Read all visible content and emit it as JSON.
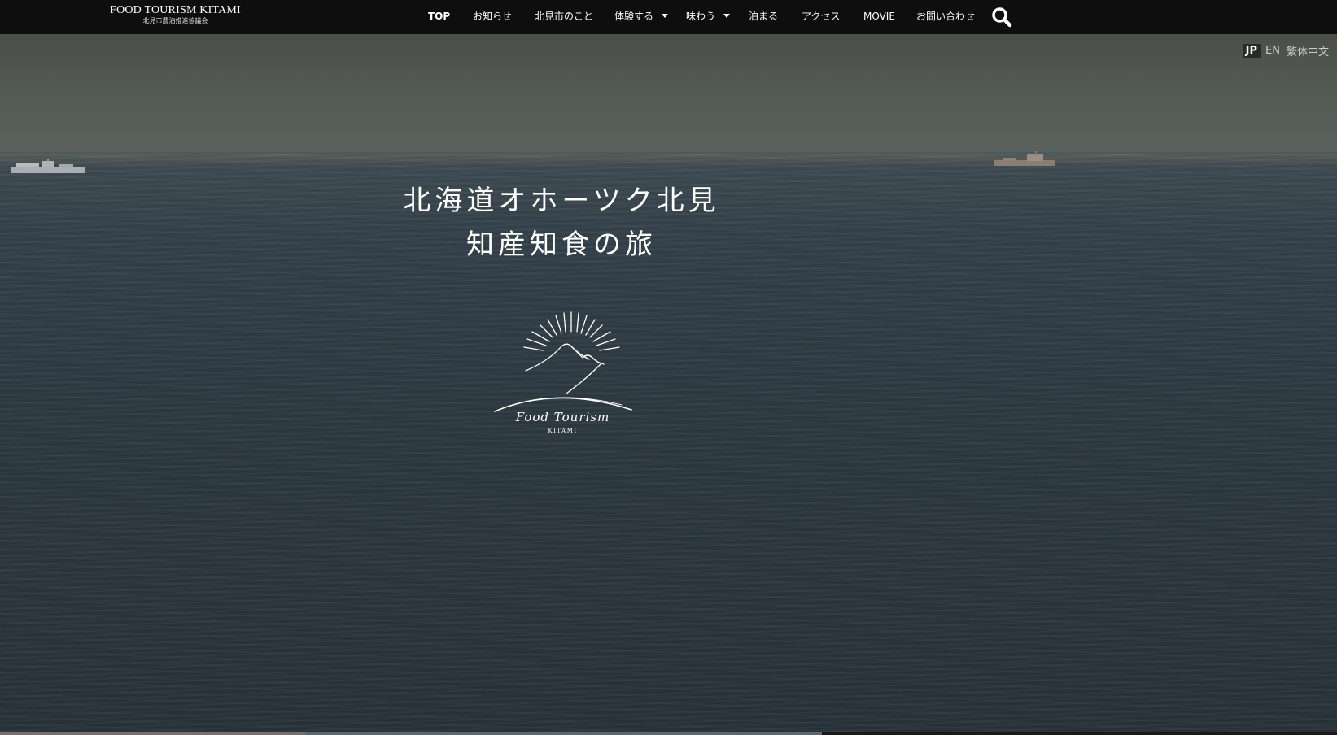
{
  "header": {
    "logo_title": "FOOD TOURISM KITAMI",
    "logo_subtitle": "北見市農泊推進協議会",
    "nav": [
      {
        "label": "TOP"
      },
      {
        "label": "お知らせ"
      },
      {
        "label": "北見市のこと"
      },
      {
        "label": "体験する"
      },
      {
        "label": "味わう"
      },
      {
        "label": "泊まる"
      },
      {
        "label": "アクセス"
      },
      {
        "label": "MOVIE"
      },
      {
        "label": "お問い合わせ"
      }
    ],
    "search_icon": "search-icon"
  },
  "lang": {
    "jp": "JP",
    "en": "EN",
    "tw": "繁体中文"
  },
  "hero": {
    "title_line1": "北海道オホーツク北見",
    "title_line2": "知産知食の旅",
    "logo_script": "Food Tourism",
    "logo_caption": "KITAMI"
  },
  "colors": {
    "header_bg": "#0e0e0e",
    "text": "#ffffff"
  }
}
